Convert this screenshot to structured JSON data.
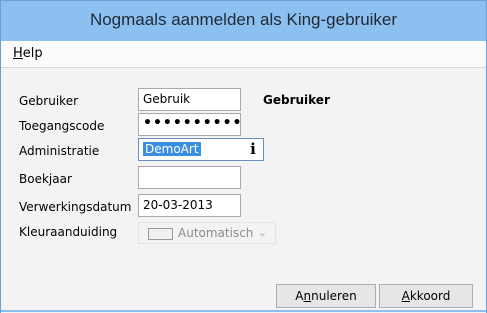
{
  "window": {
    "title": "Nogmaals aanmelden als King-gebruiker"
  },
  "menu": {
    "help": {
      "mnemonic": "H",
      "rest": "elp"
    }
  },
  "form": {
    "gebruiker": {
      "label": "Gebruiker",
      "value": "Gebruik",
      "display_name": "Gebruiker"
    },
    "toegangscode": {
      "label": "Toegangscode",
      "value": "•••••••••••"
    },
    "administratie": {
      "label": "Administratie",
      "value": "DemoArt",
      "icon": "info-icon"
    },
    "boekjaar": {
      "label": "Boekjaar",
      "value": ""
    },
    "verwerkingsdatum": {
      "label": "Verwerkingsdatum",
      "value": "20-03-2013"
    },
    "kleuraanduiding": {
      "label": "Kleuraanduiding",
      "value": "Automatisch",
      "icon": "chevron-down-icon"
    }
  },
  "buttons": {
    "annuleren": {
      "pre": "A",
      "mnemonic": "n",
      "post": "nuleren"
    },
    "akkoord": {
      "mnemonic": "A",
      "post": "kkoord"
    }
  },
  "colors": {
    "titlebar": "#8cc0f0",
    "selection": "#3b8fe0"
  }
}
